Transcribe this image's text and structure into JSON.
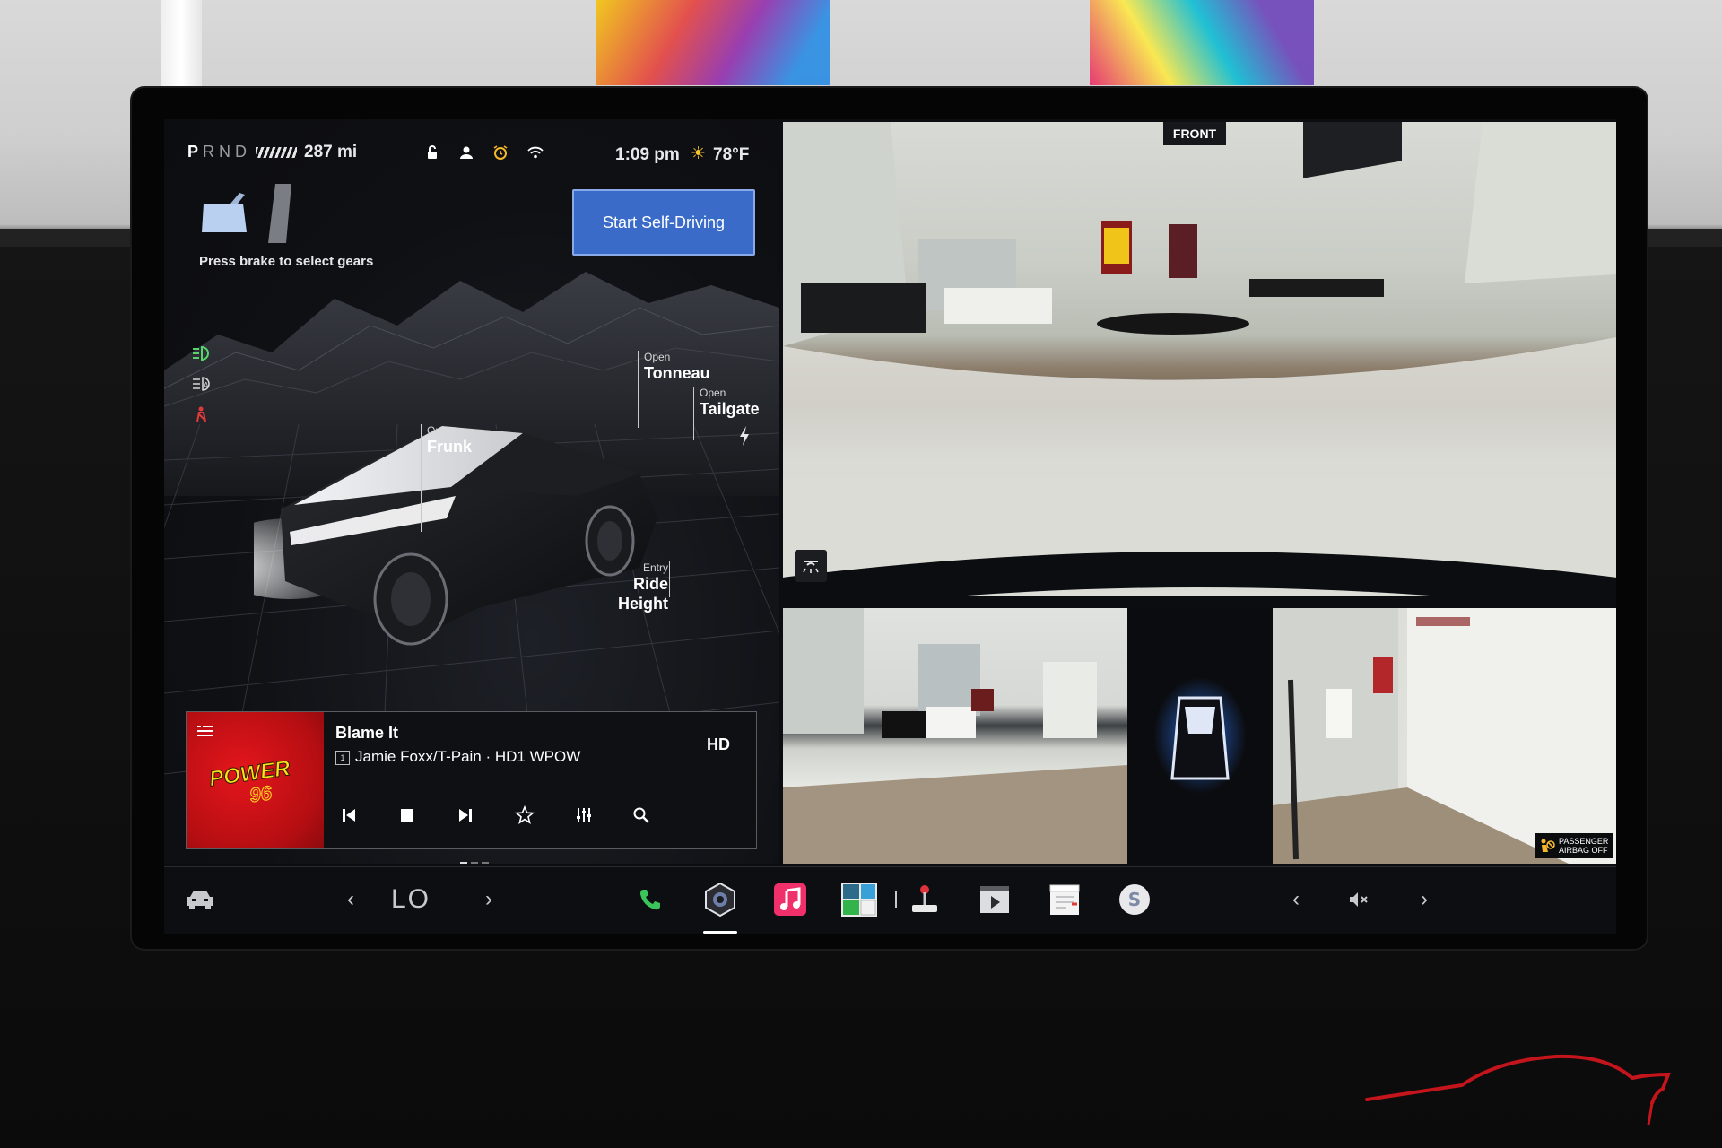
{
  "status": {
    "gears": [
      "P",
      "R",
      "N",
      "D"
    ],
    "selected_gear": "P",
    "range": "287 mi",
    "time": "1:09 pm",
    "weather_icon": "sun-icon",
    "temperature": "78°F"
  },
  "vehicle": {
    "brake_hint": "Press brake to select gears",
    "self_driving_button": "Start Self-Driving",
    "callouts": {
      "tonneau": {
        "small": "Open",
        "large": "Tonneau"
      },
      "tailgate": {
        "small": "Open",
        "large": "Tailgate"
      },
      "frunk": {
        "small": "Open",
        "large": "Frunk"
      },
      "ride_height": {
        "small": "Entry",
        "large": "Ride Height"
      }
    },
    "indicators": [
      "headlights-on-icon",
      "auto-high-beam-icon",
      "seatbelt-warning-icon"
    ],
    "colors": {
      "headlight_green": "#58d66c",
      "seatbelt_red": "#e23a3a",
      "accent_blue": "#3a6bc8"
    }
  },
  "media": {
    "station_logo": "POWER 96",
    "song_title": "Blame It",
    "hd_channel": "1",
    "artist_station": "Jamie Foxx/T-Pain · HD1 WPOW",
    "hd_icon": "HD",
    "controls": [
      "previous-icon",
      "stop-icon",
      "next-icon",
      "favorite-icon",
      "equalizer-icon",
      "search-icon"
    ]
  },
  "cameras": {
    "front_label": "FRONT",
    "airbag_label_line1": "PASSENGER",
    "airbag_label_line2": "AIRBAG OFF"
  },
  "dock": {
    "climate_temp": "LO",
    "apps": [
      "car-icon",
      "phone-icon",
      "camera-app-icon",
      "music-icon",
      "toybox-icon",
      "joystick-icon",
      "theater-icon",
      "calendar-icon",
      "spotify-icon"
    ],
    "volume_icon": "volume-muted-icon"
  }
}
